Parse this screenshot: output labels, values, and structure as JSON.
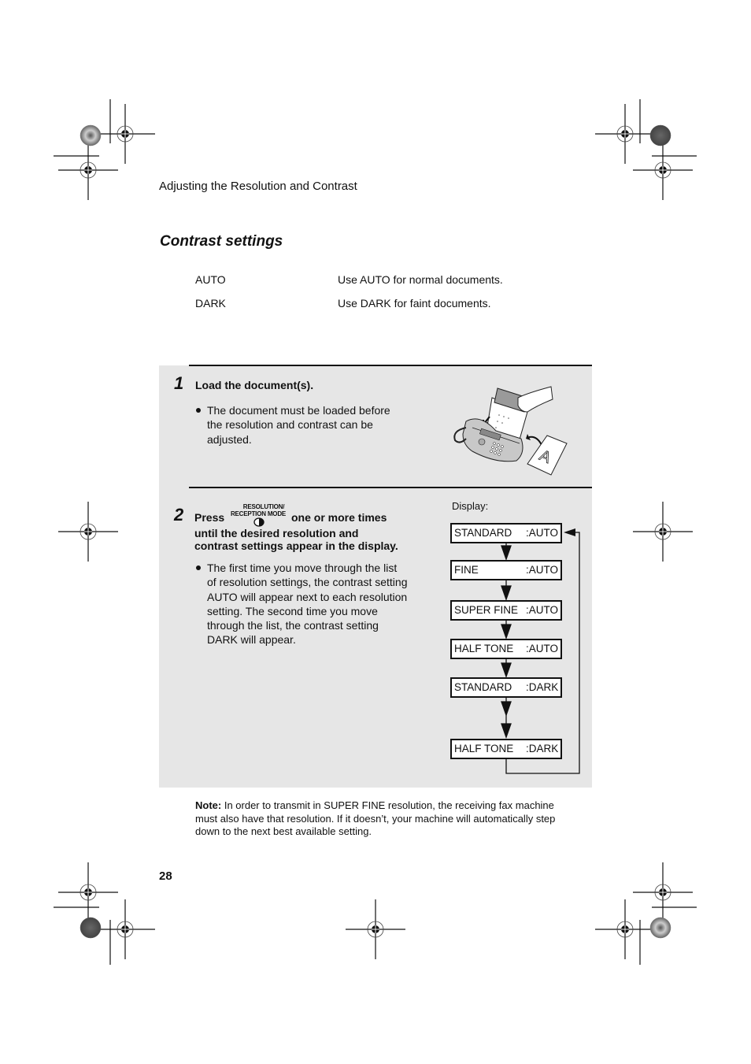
{
  "header": {
    "running_title": "Adjusting the Resolution and Contrast"
  },
  "section": {
    "title": "Contrast settings",
    "settings": [
      {
        "name": "AUTO",
        "description": "Use AUTO for normal documents."
      },
      {
        "name": "DARK",
        "description": "Use DARK for faint documents."
      }
    ]
  },
  "steps": [
    {
      "number": "1",
      "heading": "Load the document(s).",
      "bullets": [
        "The document must be loaded before the resolution and contrast can be adjusted."
      ],
      "illustration": "fax-machine-loading-document-illustration"
    },
    {
      "number": "2",
      "heading_before_key": "Press",
      "key_label_line1": "RESOLUTION/",
      "key_label_line2": "RECEPTION MODE",
      "heading_after_key": "one or more times",
      "heading_line2": "until the desired resolution and",
      "heading_line3": "contrast settings appear in the display.",
      "bullets": [
        "The first time you move through the list of resolution settings, the contrast setting AUTO will appear next to each resolution setting. The second time you move through the list, the contrast setting DARK will appear."
      ]
    }
  ],
  "display": {
    "label": "Display:",
    "sequence": [
      {
        "resolution": "STANDARD",
        "contrast": ":AUTO"
      },
      {
        "resolution": "FINE",
        "contrast": ":AUTO"
      },
      {
        "resolution": "SUPER FINE",
        "contrast": ":AUTO"
      },
      {
        "resolution": "HALF TONE",
        "contrast": ":AUTO"
      },
      {
        "resolution": "STANDARD",
        "contrast": ":DARK"
      },
      {
        "resolution": "HALF TONE",
        "contrast": ":DARK"
      }
    ]
  },
  "note": {
    "label": "Note:",
    "text": " In order to transmit in SUPER FINE resolution, the receiving fax machine must also have that resolution. If it doesn’t, your machine will automatically step down to the next best available setting."
  },
  "footer": {
    "page_number": "28"
  },
  "colors": {
    "panel_bg": "#e6e6e6",
    "text": "#111111"
  }
}
